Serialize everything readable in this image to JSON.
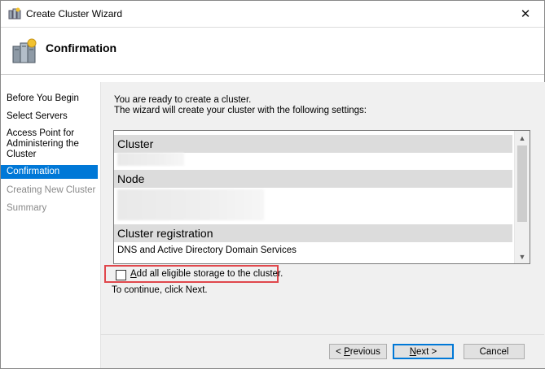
{
  "window": {
    "title": "Create Cluster Wizard",
    "close_glyph": "✕"
  },
  "header": {
    "title": "Confirmation",
    "icon": "cluster-servers-icon"
  },
  "sidebar": {
    "items": [
      {
        "label": "Before You Begin",
        "state": "normal"
      },
      {
        "label": "Select Servers",
        "state": "normal"
      },
      {
        "label": "Access Point for",
        "state": "normal"
      },
      {
        "label": "Administering the",
        "state": "normal"
      },
      {
        "label": "Cluster",
        "state": "normal"
      },
      {
        "label": "Confirmation",
        "state": "active"
      },
      {
        "label": "Creating New Cluster",
        "state": "disabled"
      },
      {
        "label": "Summary",
        "state": "disabled"
      }
    ]
  },
  "main": {
    "intro_line1": "You are ready to create a cluster.",
    "intro_line2": "The wizard will create your cluster with the following settings:",
    "settings": {
      "cluster_heading": "Cluster",
      "node_heading": "Node",
      "registration_heading": "Cluster registration",
      "registration_value": "DNS and Active Directory Domain Services"
    },
    "storage_checkbox": {
      "prefix": "",
      "accel": "A",
      "rest": "dd all eligible storage to the cluster.",
      "checked": false
    },
    "continue_text": "To continue, click Next."
  },
  "buttons": {
    "previous_prefix": "< ",
    "previous_accel": "P",
    "previous_rest": "revious",
    "next_accel": "N",
    "next_rest": "ext >",
    "cancel": "Cancel"
  },
  "colors": {
    "accent": "#0078d7",
    "highlight_border": "#e0474c",
    "section_bg": "#dcdcdc"
  }
}
